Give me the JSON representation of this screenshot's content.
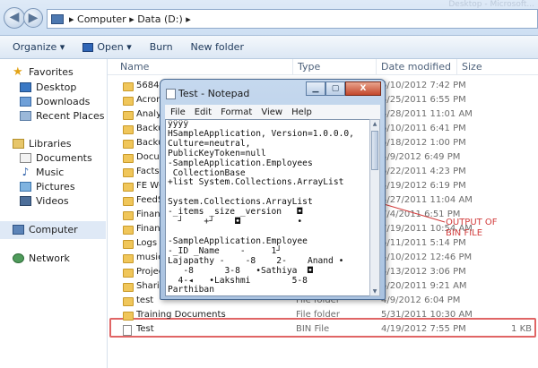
{
  "address": {
    "back_glyph": "◀",
    "forward_glyph": "▶",
    "path": "▸  Computer  ▸  Data (D:)  ▸",
    "faint_title": "Desktop - Microsoft..."
  },
  "toolbar": {
    "organize": "Organize ▾",
    "open": "Open ▾",
    "burn": "Burn",
    "new_folder": "New folder"
  },
  "sidebar": {
    "favorites": "Favorites",
    "desktop": "Desktop",
    "downloads": "Downloads",
    "recent": "Recent Places",
    "libraries": "Libraries",
    "documents": "Documents",
    "music": "Music",
    "pictures": "Pictures",
    "videos": "Videos",
    "computer": "Computer",
    "network": "Network"
  },
  "columns": {
    "name": "Name",
    "type": "Type",
    "date": "Date modified",
    "size": "Size"
  },
  "files": [
    {
      "name": "568489",
      "type": "",
      "date": "5/10/2012 7:42 PM",
      "size": ""
    },
    {
      "name": "Acroni",
      "type": "",
      "date": "4/25/2011 6:55 PM",
      "size": ""
    },
    {
      "name": "Analyti",
      "type": "",
      "date": "4/28/2011 11:01 AM",
      "size": ""
    },
    {
      "name": "Backup",
      "type": "",
      "date": "5/10/2011 6:41 PM",
      "size": ""
    },
    {
      "name": "Backup",
      "type": "",
      "date": "5/18/2012 1:00 PM",
      "size": ""
    },
    {
      "name": "Docume",
      "type": "",
      "date": "4/9/2012 6:49 PM",
      "size": ""
    },
    {
      "name": "Factsh",
      "type": "",
      "date": "5/22/2011 4:23 PM",
      "size": ""
    },
    {
      "name": "FE WO",
      "type": "",
      "date": "4/19/2012 6:19 PM",
      "size": ""
    },
    {
      "name": "FeedSy",
      "type": "",
      "date": "4/27/2011 11:04 AM",
      "size": ""
    },
    {
      "name": "Financ",
      "type": "",
      "date": "7/4/2011 6:51 PM",
      "size": ""
    },
    {
      "name": "Financ",
      "type": "",
      "date": "7/19/2011 10:54 AM",
      "size": ""
    },
    {
      "name": "Logs",
      "type": "",
      "date": "5/11/2011 5:14 PM",
      "size": ""
    },
    {
      "name": "music",
      "type": "",
      "date": "4/10/2012 12:46 PM",
      "size": ""
    },
    {
      "name": "Project",
      "type": "",
      "date": "4/13/2012 3:06 PM",
      "size": ""
    },
    {
      "name": "Sharing",
      "type": "",
      "date": "5/20/2011 9:21 AM",
      "size": ""
    },
    {
      "name": "test",
      "type": "File folder",
      "date": "4/9/2012 6:04 PM",
      "size": ""
    },
    {
      "name": "Training Documents",
      "type": "File folder",
      "date": "5/31/2011 10:30 AM",
      "size": ""
    },
    {
      "name": "Test",
      "type": "BIN File",
      "date": "4/19/2012 7:55 PM",
      "size": "1 KB"
    }
  ],
  "notepad": {
    "title": "Test - Notepad",
    "btn_min": "▁",
    "btn_max": "▢",
    "btn_close": "X",
    "menu": [
      "File",
      "Edit",
      "Format",
      "View",
      "Help"
    ],
    "content": "ÿÿÿÿ\nHSampleApplication, Version=1.0.0.0,\nCulture=neutral,\nPublicKeyToken=null\n-SampleApplication.Employees\n CollectionBase\n+list System.Collections.ArrayList\n\nSystem.Collections.ArrayList\n-_items _size _version   ◘\n  ┘    +┘    ◘           •\n\n-SampleApplication.Employee\n-_ID _Name    -     1┘\nLajapathy -    -8    2-    Anand •\n   -8      3-8   •Sathiya  ◘\n  4-◂   •Lakshmi        5-8\nParthiban"
  },
  "annotation": "OUTPUT OF\nBIN FILE"
}
